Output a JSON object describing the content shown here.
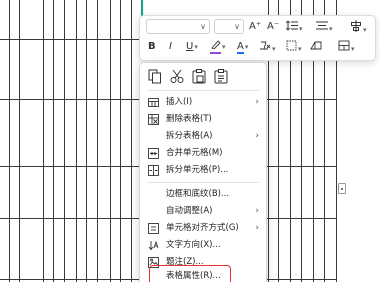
{
  "colors": {
    "table_line": "#3a3a3a",
    "table_accent": "#1ea38a",
    "highlight_border": "#e8332e",
    "font_color_underline": "#e53935",
    "highlight_color_underline": "#8e4bd8",
    "text_color_underline": "#1e6bff"
  },
  "toolbar": {
    "grow_font": "A⁺",
    "shrink_font": "A⁻",
    "bold": "B",
    "italic": "I",
    "underline": "U",
    "font_color": "A"
  },
  "menu": {
    "items": [
      {
        "label": "插入(I)",
        "icon": "insert-table-icon",
        "submenu": true
      },
      {
        "label": "删除表格(T)",
        "icon": "delete-table-icon",
        "submenu": false
      },
      {
        "label": "拆分表格(A)",
        "icon": "",
        "submenu": true
      },
      {
        "label": "合并单元格(M)",
        "icon": "merge-cells-icon",
        "submenu": false
      },
      {
        "label": "拆分单元格(P)...",
        "icon": "split-cells-icon",
        "submenu": false
      },
      {
        "label": "边框和底纹(B)...",
        "icon": "",
        "submenu": false
      },
      {
        "label": "自动调整(A)",
        "icon": "",
        "submenu": true
      },
      {
        "label": "单元格对齐方式(G)",
        "icon": "cell-align-icon",
        "submenu": true
      },
      {
        "label": "文字方向(X)...",
        "icon": "text-direction-icon",
        "submenu": false
      },
      {
        "label": "题注(Z)...",
        "icon": "caption-icon",
        "submenu": false
      },
      {
        "label": "表格属性(R)...",
        "icon": "",
        "submenu": false
      }
    ]
  }
}
